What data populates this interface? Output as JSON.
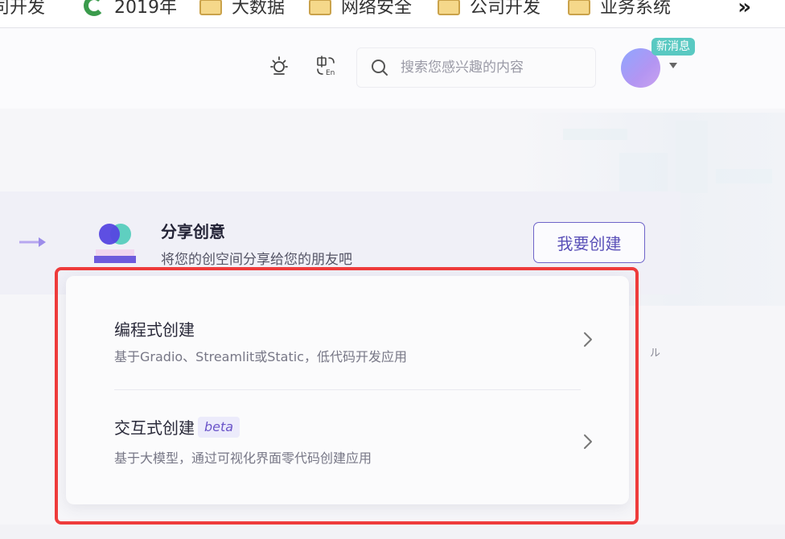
{
  "bookmarks": {
    "items": [
      {
        "label": "司开发",
        "icon": "folder-icon"
      },
      {
        "label": "2019年",
        "icon": "bookmark-site-icon"
      },
      {
        "label": "大数据",
        "icon": "folder-icon"
      },
      {
        "label": "网络安全",
        "icon": "folder-icon"
      },
      {
        "label": "公司开发",
        "icon": "folder-icon"
      },
      {
        "label": "业务系统",
        "icon": "folder-icon"
      }
    ],
    "overflow_label": "»"
  },
  "header": {
    "theme_icon": "sun-icon",
    "language_icon": "language-switch-icon",
    "search": {
      "placeholder": "搜索您感兴趣的内容",
      "icon": "search-icon"
    },
    "notification_badge": "新消息"
  },
  "banner": {
    "title": "分享创意",
    "subtitle": "将您的创空间分享给您的朋友吧",
    "button_label": "我要创建"
  },
  "dropdown": {
    "options": [
      {
        "title": "编程式创建",
        "description": "基于Gradio、Streamlit或Static，低代码开发应用",
        "tag": ""
      },
      {
        "title": "交互式创建",
        "description": "基于大模型，通过可视化界面零代码创建应用",
        "tag": "beta"
      }
    ]
  },
  "side_text": "ル",
  "colors": {
    "accent": "#6e64c9",
    "highlight_border": "#ee3b3b",
    "badge": "#59c9c2"
  }
}
